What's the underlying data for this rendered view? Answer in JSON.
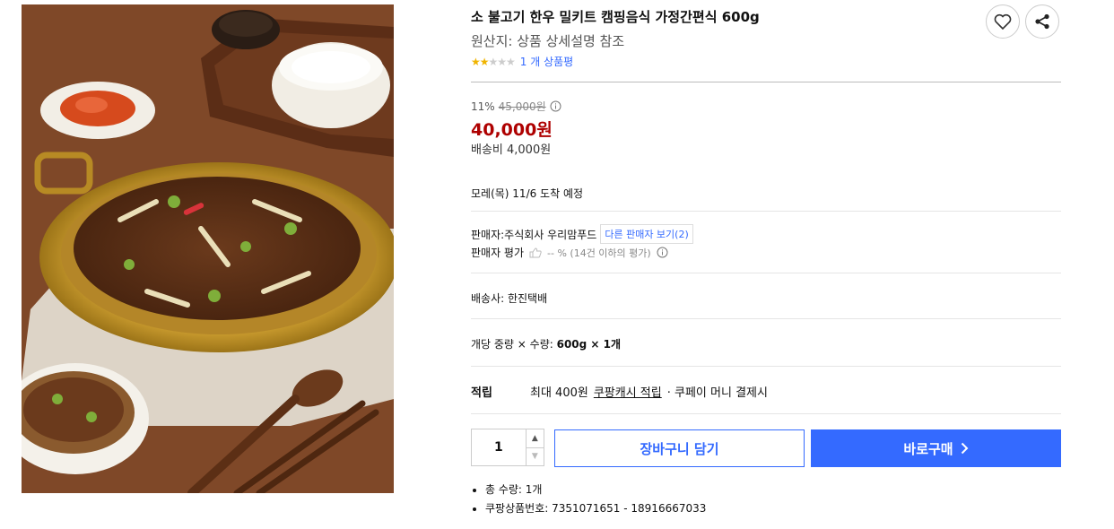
{
  "product": {
    "title": "소 불고기 한우 밀키트 캠핑음식 가정간편식 600g",
    "origin": "원산지: 상품 상세설명 참조",
    "rating_stars": 2,
    "rating_max": 5,
    "review_link": "1 개 상품평"
  },
  "actions": {
    "wishlist_icon": "heart-icon",
    "share_icon": "share-icon"
  },
  "price": {
    "discount_rate": "11%",
    "original": "45,000원",
    "sale": "40,000원",
    "shipping": "배송비 4,000원",
    "sale_color": "#ae0000"
  },
  "delivery": {
    "arrival": "모레(목) 11/6 도착 예정"
  },
  "seller": {
    "name": "판매자:주식회사 우리맘푸드",
    "other_sellers": "다른 판매자 보기(2)",
    "rating_label": "판매자 평가",
    "rating_value": "-- % (14건 이하의 평가)"
  },
  "courier": {
    "text": "배송사:  한진택배"
  },
  "option": {
    "label": "개당 중량 × 수량: ",
    "value": "600g × 1개"
  },
  "reward": {
    "label": "적립",
    "amount": "최대 400원",
    "link": "쿠팡캐시 적립",
    "suffix": "· 쿠페이 머니 결제시"
  },
  "purchase": {
    "quantity": "1",
    "cart_label": "장바구니 담기",
    "buy_label": "바로구매",
    "accent": "#346aff"
  },
  "summary": {
    "total_qty": "총 수량: 1개",
    "product_no": "쿠팡상품번호: 7351071651 - 18916667033"
  }
}
